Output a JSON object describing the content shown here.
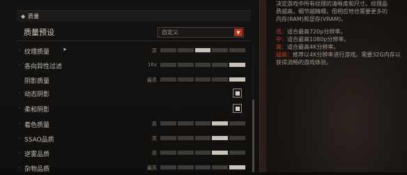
{
  "section": {
    "icon": "collapse-icon",
    "title": "质量"
  },
  "preset": {
    "label": "质量预设",
    "value": "自定义"
  },
  "settings": [
    {
      "name": "纹理质量",
      "value": "高",
      "type": "slider",
      "level": 3,
      "max": 5
    },
    {
      "name": "各向异性过滤",
      "value": "16x",
      "type": "slider",
      "level": 5,
      "max": 5
    },
    {
      "name": "阴影质量",
      "value": "最高",
      "type": "slider",
      "level": 5,
      "max": 5
    },
    {
      "name": "动态阴影",
      "value": "",
      "type": "checkbox",
      "checked": true
    },
    {
      "name": "柔和阴影",
      "value": "",
      "type": "checkbox",
      "checked": true
    },
    {
      "name": "着色质量",
      "value": "高",
      "type": "slider",
      "level": 4,
      "max": 5
    },
    {
      "name": "SSAO品质",
      "value": "高",
      "type": "slider",
      "level": 4,
      "max": 5
    },
    {
      "name": "逆雾品质",
      "value": "高",
      "type": "slider",
      "level": 4,
      "max": 5
    },
    {
      "name": "杂物品质",
      "value": "最高",
      "type": "slider",
      "level": 5,
      "max": 5
    }
  ],
  "help": {
    "line1": "决定游戏中所有纹理的清晰度和尺寸。纹理品",
    "line2": "质越高，细节越精细，但相应地也需要更多的",
    "line3": "内存(RAM)和显存(VRAM)。",
    "levels": [
      {
        "key": "低：",
        "text": "适合最高720p分辨率。"
      },
      {
        "key": "中：",
        "text": "适合最高1080p分辨率。"
      },
      {
        "key": "高：",
        "text": "适合最高4K分辨率。"
      },
      {
        "key": "超高：",
        "text": "推荐以4K分辨率进行游戏。需要32G内存以获得流畅的游戏体验。"
      }
    ]
  },
  "colors": {
    "accent": "#b5301c",
    "level_key": "#c0392b"
  }
}
